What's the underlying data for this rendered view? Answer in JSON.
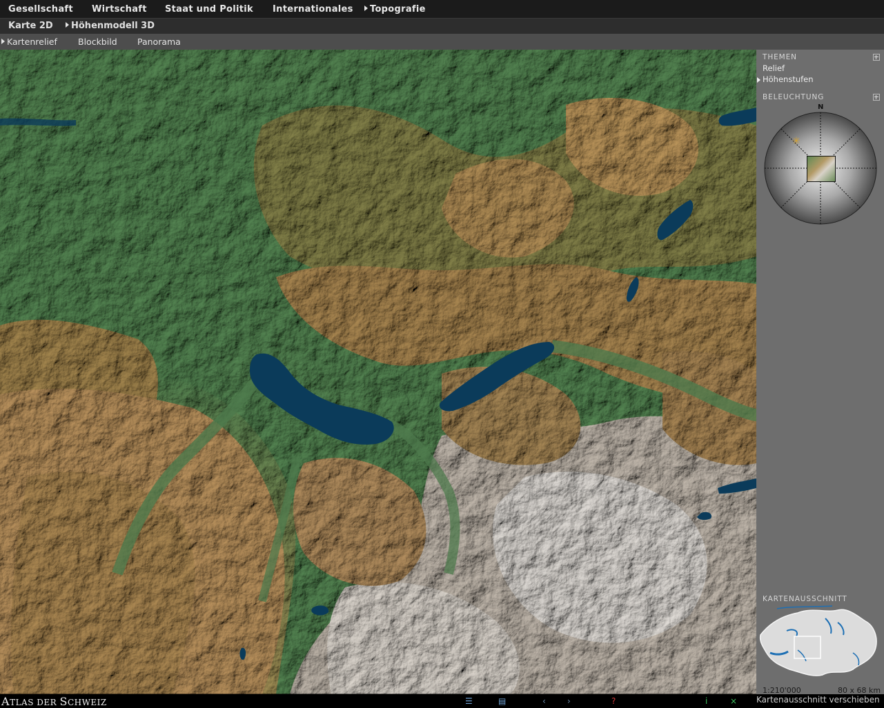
{
  "nav": {
    "main": [
      {
        "label": "Gesellschaft",
        "active": false
      },
      {
        "label": "Wirtschaft",
        "active": false
      },
      {
        "label": "Staat und Politik",
        "active": false
      },
      {
        "label": "Internationales",
        "active": false
      },
      {
        "label": "Topografie",
        "active": true
      }
    ],
    "sub": [
      {
        "label": "Karte 2D",
        "active": false
      },
      {
        "label": "Höhenmodell 3D",
        "active": true
      }
    ],
    "views": [
      {
        "label": "Kartenrelief",
        "active": true
      },
      {
        "label": "Blockbild",
        "active": false
      },
      {
        "label": "Panorama",
        "active": false
      }
    ]
  },
  "sidebar": {
    "themes_title": "THEMEN",
    "themes": [
      {
        "label": "Relief",
        "active": false
      },
      {
        "label": "Höhenstufen",
        "active": true
      }
    ],
    "lighting_title": "BELEUCHTUNG",
    "compass_north": "N",
    "extent_title": "KARTENAUSSCHNITT",
    "scale": "1:210'000",
    "size": "80 x 68 km"
  },
  "footer": {
    "logo_first": "A",
    "logo_rest": "TLAS DER ",
    "logo_first2": "S",
    "logo_rest2": "CHWEIZ",
    "status": "Kartenausschnitt verschieben",
    "icons": [
      "list-icon",
      "legend-icon",
      "back-icon",
      "forward-icon",
      "help-icon",
      "info-icon",
      "close-icon"
    ]
  },
  "colors": {
    "lake": "#0b3b5a",
    "lowland": "#4d7a4c",
    "midland": "#a88a56",
    "alpine": "#c9c4bd",
    "panel": "#6e6e6e"
  }
}
